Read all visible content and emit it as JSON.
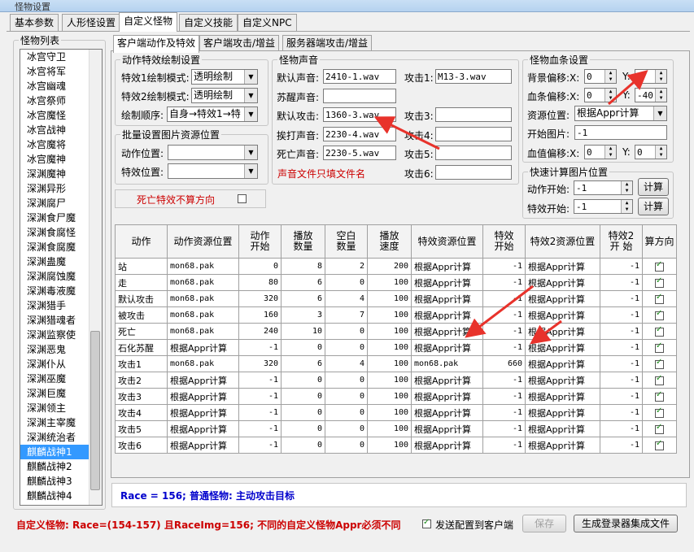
{
  "window": {
    "title": "怪物设置"
  },
  "main_tabs": [
    {
      "label": "基本参数"
    },
    {
      "label": "人形怪设置"
    },
    {
      "label": "自定义怪物"
    },
    {
      "label": "自定义技能"
    },
    {
      "label": "自定义NPC"
    }
  ],
  "monster_list": {
    "legend": "怪物列表",
    "items": [
      "冰宫守卫",
      "冰宫将军",
      "冰宫幽魂",
      "冰宫祭师",
      "冰宫魔怪",
      "冰宫战神",
      "冰宫魔将",
      "冰宫魔神",
      "深渊魔神",
      "深渊异形",
      "深渊腐尸",
      "深渊食尸魔",
      "深渊食腐怪",
      "深渊食腐魔",
      "深渊蛊魔",
      "深渊腐蚀魔",
      "深渊毒液魔",
      "深渊猎手",
      "深渊猎魂者",
      "深渊监察使",
      "深渊恶鬼",
      "深渊仆从",
      "深渊巫魔",
      "深渊巨魔",
      "深渊领主",
      "深渊主宰魔",
      "深渊统治者",
      "麒麟战神1",
      "麒麟战神2",
      "麒麟战神3",
      "麒麟战神4"
    ],
    "selected": "麒麟战神1"
  },
  "sub_tabs": [
    {
      "label": "客户端动作及特效"
    },
    {
      "label": "客户端攻击/增益"
    },
    {
      "label": "服务器端攻击/增益"
    }
  ],
  "effect_draw": {
    "legend": "动作特效绘制设置",
    "effect1_label": "特效1绘制模式:",
    "effect1_value": "透明绘制",
    "effect2_label": "特效2绘制模式:",
    "effect2_value": "透明绘制",
    "order_label": "绘制顺序:",
    "order_value": "自身→特效1→特"
  },
  "batch_res": {
    "legend": "批量设置图片资源位置",
    "action_label": "动作位置:",
    "action_value": "",
    "effect_label": "特效位置:",
    "effect_value": ""
  },
  "death_effect": {
    "label": "死亡特效不算方向"
  },
  "sound": {
    "legend": "怪物声音",
    "default_label": "默认声音:",
    "default_value": "2410-1.wav",
    "revive_label": "苏醒声音:",
    "revive_value": "",
    "attack_default_label": "默认攻击:",
    "attack_default_value": "1360-3.wav",
    "hit_label": "挨打声音:",
    "hit_value": "2230-4.wav",
    "death_label": "死亡声音:",
    "death_value": "2230-5.wav",
    "attack1_label": "攻击1:",
    "attack1_value": "M13-3.wav",
    "attack3_label": "攻击3:",
    "attack3_value": "",
    "attack4_label": "攻击4:",
    "attack4_value": "",
    "attack5_label": "攻击5:",
    "attack5_value": "",
    "attack6_label": "攻击6:",
    "attack6_value": "",
    "note": "声音文件只填文件名"
  },
  "hpbar": {
    "legend": "怪物血条设置",
    "bg_offset_label": "背景偏移:X:",
    "bg_x": "0",
    "bg_y_label": "Y:",
    "bg_y": "0",
    "bar_offset_label": "血条偏移:X:",
    "bar_x": "0",
    "bar_y_label": "Y:",
    "bar_y": "-40",
    "res_label": "资源位置:",
    "res_value": "根据Appr计算",
    "start_label": "开始图片:",
    "start_value": "-1",
    "val_offset_label": "血值偏移:X:",
    "val_x": "0",
    "val_y_label": "Y:",
    "val_y": "0"
  },
  "quick_calc": {
    "legend": "快速计算图片位置",
    "action_start_label": "动作开始:",
    "action_start_value": "-1",
    "effect_start_label": "特效开始:",
    "effect_start_value": "-1",
    "calc_label": "计算"
  },
  "table": {
    "headers": [
      "动作",
      "动作资源位置",
      "动作\n开始",
      "播放\n数量",
      "空白\n数量",
      "播放\n速度",
      "特效资源位置",
      "特效\n开始",
      "特效2资源位置",
      "特效2\n开 始",
      "算方向"
    ],
    "rows": [
      [
        "站",
        "mon68.pak",
        "0",
        "8",
        "2",
        "200",
        "根据Appr计算",
        "-1",
        "根据Appr计算",
        "-1"
      ],
      [
        "走",
        "mon68.pak",
        "80",
        "6",
        "0",
        "100",
        "根据Appr计算",
        "-1",
        "根据Appr计算",
        "-1"
      ],
      [
        "默认攻击",
        "mon68.pak",
        "320",
        "6",
        "4",
        "100",
        "根据Appr计算",
        "-1",
        "根据Appr计算",
        "-1"
      ],
      [
        "被攻击",
        "mon68.pak",
        "160",
        "3",
        "7",
        "100",
        "根据Appr计算",
        "-1",
        "根据Appr计算",
        "-1"
      ],
      [
        "死亡",
        "mon68.pak",
        "240",
        "10",
        "0",
        "100",
        "根据Appr计算",
        "-1",
        "根据Appr计算",
        "-1"
      ],
      [
        "石化苏醒",
        "根据Appr计算",
        "-1",
        "0",
        "0",
        "100",
        "根据Appr计算",
        "-1",
        "根据Appr计算",
        "-1"
      ],
      [
        "攻击1",
        "mon68.pak",
        "320",
        "6",
        "4",
        "100",
        "mon68.pak",
        "660",
        "根据Appr计算",
        "-1"
      ],
      [
        "攻击2",
        "根据Appr计算",
        "-1",
        "0",
        "0",
        "100",
        "根据Appr计算",
        "-1",
        "根据Appr计算",
        "-1"
      ],
      [
        "攻击3",
        "根据Appr计算",
        "-1",
        "0",
        "0",
        "100",
        "根据Appr计算",
        "-1",
        "根据Appr计算",
        "-1"
      ],
      [
        "攻击4",
        "根据Appr计算",
        "-1",
        "0",
        "0",
        "100",
        "根据Appr计算",
        "-1",
        "根据Appr计算",
        "-1"
      ],
      [
        "攻击5",
        "根据Appr计算",
        "-1",
        "0",
        "0",
        "100",
        "根据Appr计算",
        "-1",
        "根据Appr计算",
        "-1"
      ],
      [
        "攻击6",
        "根据Appr计算",
        "-1",
        "0",
        "0",
        "100",
        "根据Appr计算",
        "-1",
        "根据Appr计算",
        "-1"
      ]
    ]
  },
  "info": {
    "text": "Race = 156; 普通怪物: 主动攻击目标"
  },
  "footer": {
    "note": "自定义怪物: Race=(154-157) 且RaceImg=156; 不同的自定义怪物Appr必须不同",
    "send_label": "发送配置到客户端",
    "save_label": "保存",
    "generate_label": "生成登录器集成文件"
  },
  "colors": {
    "accent_red": "#cc0000",
    "info_blue": "#0000cc",
    "selection": "#3399ff",
    "arrow": "#e8322b"
  }
}
